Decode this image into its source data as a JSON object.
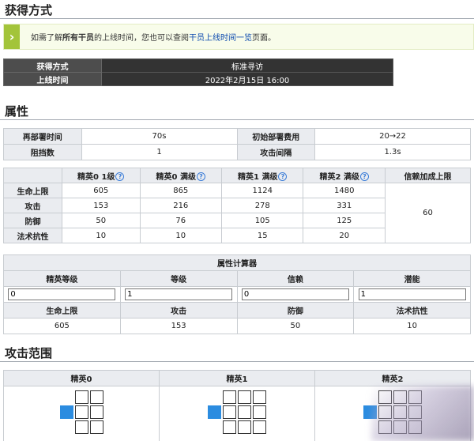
{
  "sections": {
    "acquire_title": "获得方式",
    "attr_title": "属性",
    "range_title": "攻击范围"
  },
  "notice": {
    "prefix": "如需了解",
    "bold": "所有干员",
    "middle": "的上线时间，您也可以查阅",
    "link": "干员上线时间一览",
    "suffix": "页面。"
  },
  "acquire": {
    "rows": [
      {
        "label": "获得方式",
        "value": "标准寻访"
      },
      {
        "label": "上线时间",
        "value": "2022年2月15日 16:00"
      }
    ]
  },
  "basic": {
    "rows": [
      {
        "l1": "再部署时间",
        "v1": "70s",
        "l2": "初始部署费用",
        "v2": "20→22"
      },
      {
        "l1": "阻挡数",
        "v1": "1",
        "l2": "攻击间隔",
        "v2": "1.3s"
      }
    ]
  },
  "elite": {
    "headers": [
      "精英0 1级",
      "精英0 满级",
      "精英1 满级",
      "精英2 满级",
      "信赖加成上限"
    ],
    "rows": [
      {
        "label": "生命上限",
        "values": [
          "605",
          "865",
          "1124",
          "1480"
        ]
      },
      {
        "label": "攻击",
        "values": [
          "153",
          "216",
          "278",
          "331"
        ]
      },
      {
        "label": "防御",
        "values": [
          "50",
          "76",
          "105",
          "125"
        ]
      },
      {
        "label": "法术抗性",
        "values": [
          "10",
          "10",
          "15",
          "20"
        ]
      }
    ],
    "trust_value": "60"
  },
  "calc": {
    "title": "属性计算器",
    "input_labels": [
      "精英等级",
      "等级",
      "信赖",
      "潜能"
    ],
    "input_values": [
      "0",
      "1",
      "0",
      "1"
    ],
    "result_labels": [
      "生命上限",
      "攻击",
      "防御",
      "法术抗性"
    ],
    "result_values": [
      "605",
      "153",
      "50",
      "10"
    ]
  },
  "range": {
    "headers": [
      "精英0",
      "精英1",
      "精英2"
    ]
  }
}
